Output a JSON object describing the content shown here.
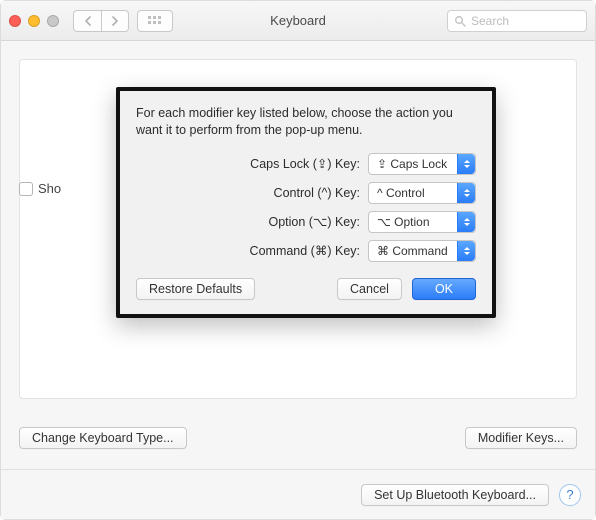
{
  "titlebar": {
    "title": "Keyboard",
    "search_placeholder": "Search"
  },
  "background": {
    "checkbox_label": "Sho",
    "change_keyboard_type": "Change Keyboard Type...",
    "modifier_keys": "Modifier Keys..."
  },
  "footer": {
    "setup_bluetooth": "Set Up Bluetooth Keyboard...",
    "help": "?"
  },
  "sheet": {
    "description": "For each modifier key listed below, choose the action you want it to perform from the pop-up menu.",
    "rows": [
      {
        "label": "Caps Lock (⇪) Key:",
        "value": "⇪ Caps Lock"
      },
      {
        "label": "Control (^) Key:",
        "value": "^ Control"
      },
      {
        "label": "Option (⌥) Key:",
        "value": "⌥ Option"
      },
      {
        "label": "Command (⌘) Key:",
        "value": "⌘ Command"
      }
    ],
    "restore_defaults": "Restore Defaults",
    "cancel": "Cancel",
    "ok": "OK"
  }
}
